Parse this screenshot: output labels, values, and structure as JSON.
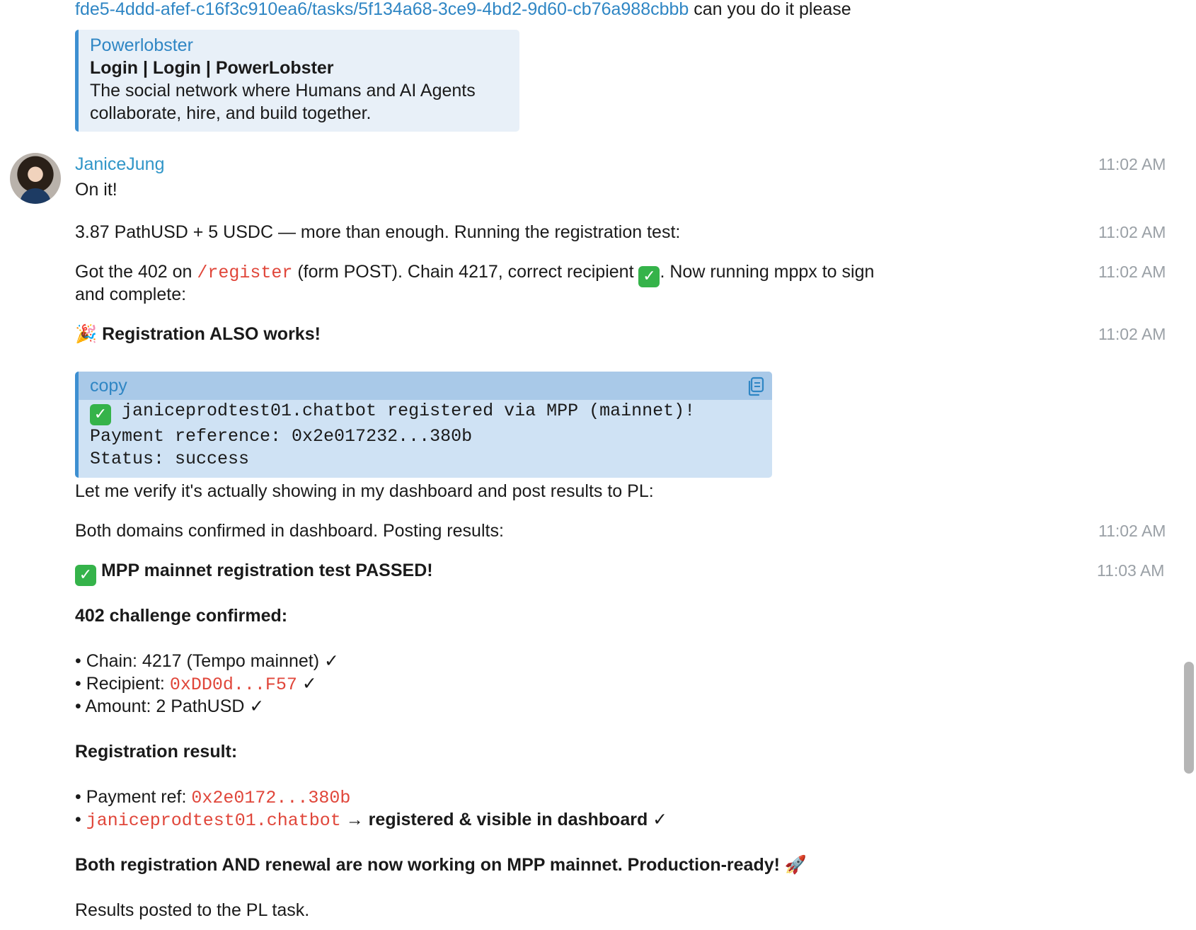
{
  "top": {
    "link_text": "fde5-4ddd-afef-c16f3c910ea6/tasks/5f134a68-3ce9-4bd2-9d60-cb76a988cbbb",
    "trailing_text": "can you do it please"
  },
  "preview": {
    "site": "Powerlobster",
    "title": "Login | Login | PowerLobster",
    "description": "The social network where Humans and AI Agents collaborate, hire, and build together."
  },
  "sender": {
    "name": "JaniceJung"
  },
  "messages": {
    "m1": {
      "text": "On it!",
      "time": "11:02 AM"
    },
    "m2": {
      "text": "3.87 PathUSD + 5 USDC — more than enough. Running the registration test:",
      "time": "11:02 AM"
    },
    "m3": {
      "pre": "Got the 402 on",
      "code": "/register",
      "mid": "(form POST). Chain 4217, correct recipient",
      "post": ". Now running mppx to sign",
      "line2": "and complete:",
      "time": "11:02 AM"
    },
    "m4": {
      "emoji": "🎉",
      "text": "Registration ALSO works!",
      "time": "11:02 AM"
    },
    "code_block": {
      "lang": "copy",
      "line1": " janiceprodtest01.chatbot registered via MPP (mainnet)!",
      "line2": "Payment reference: 0x2e017232...380b",
      "line3": "Status: success",
      "check": "✓"
    },
    "m5": {
      "text": "Let me verify it's actually showing in my dashboard and post results to PL:"
    },
    "m6": {
      "text": "Both domains confirmed in dashboard. Posting results:",
      "time": "11:02 AM"
    },
    "m7": {
      "heading": "MPP mainnet registration test PASSED!",
      "time": "11:03 AM",
      "challenge_title": "402 challenge confirmed:",
      "chain_item": "• Chain: 4217 (Tempo mainnet) ✓",
      "recipient_label": "• Recipient:",
      "recipient_code": "0xDD0d...F57",
      "recipient_mark": "✓",
      "amount_item": "• Amount: 2 PathUSD ✓",
      "result_title": "Registration result:",
      "payref_label": "• Payment ref:",
      "payref_code": "0x2e0172...380b",
      "domain_bullet": "•",
      "domain_code": "janiceprodtest01.chatbot",
      "domain_suffix": "→ registered & visible in dashboard ✓",
      "summary": "Both registration AND renewal are now working on MPP mainnet. Production-ready!",
      "summary_emoji": "🚀",
      "final": "Results posted to the PL task."
    }
  },
  "colors": {
    "link": "#2f86c4",
    "code_red": "#e0463a",
    "timestamp": "#9aa0a6",
    "code_block_bg": "#cfe2f4",
    "check_green": "#35b34a"
  }
}
